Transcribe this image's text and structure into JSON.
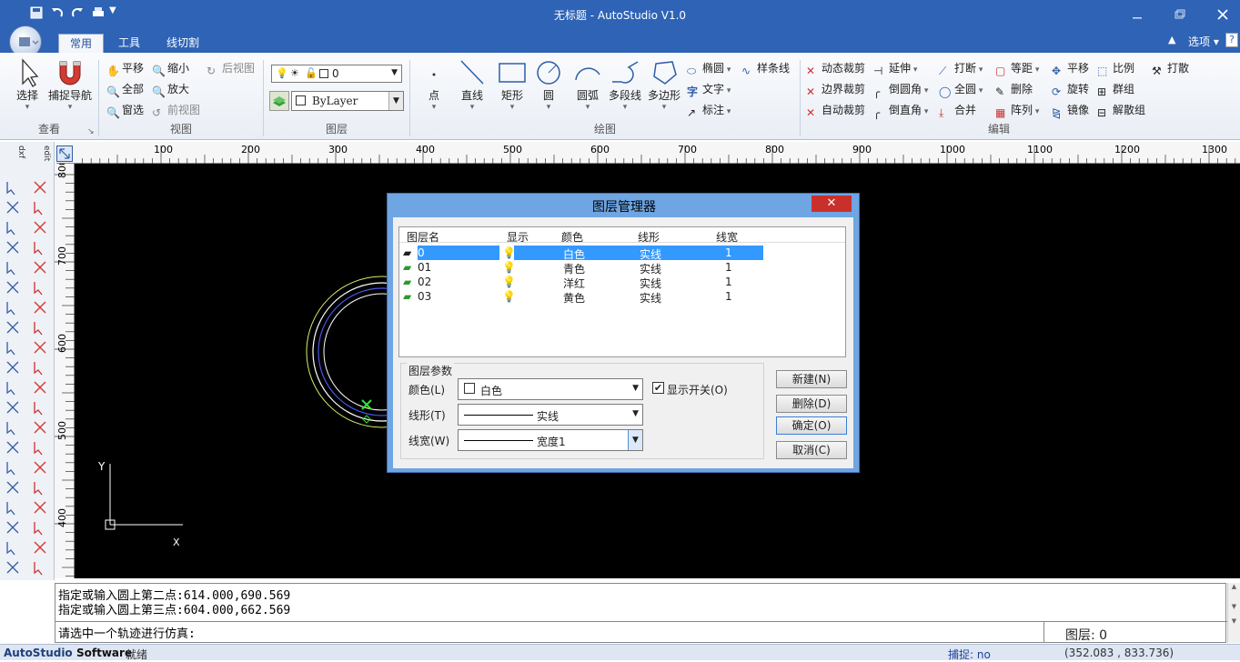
{
  "window": {
    "title": "无标题 - AutoStudio V1.0",
    "options_label": "选项"
  },
  "tabs": [
    "常用",
    "工具",
    "线切割"
  ],
  "ribbon": {
    "view_group": {
      "label": "查看",
      "select": "选择",
      "snap_nav": "捕捉导航"
    },
    "zoom_group": {
      "label": "视图",
      "pan": "平移",
      "zoom_out": "缩小",
      "all": "全部",
      "zoom_in": "放大",
      "window": "窗选",
      "prev_view": "前视图",
      "next_view": "后视图"
    },
    "layer_group": {
      "label": "图层",
      "current_layer": "0",
      "linetype": "ByLayer"
    },
    "draw_group": {
      "label": "绘图",
      "items": [
        "点",
        "直线",
        "矩形",
        "圆",
        "圆弧",
        "多段线",
        "多边形"
      ],
      "ellipse": "椭圆",
      "spline": "样条线",
      "text": "文字",
      "dim": "标注"
    },
    "edit_group": {
      "label": "编辑",
      "c1": [
        "动态裁剪",
        "边界裁剪",
        "自动裁剪"
      ],
      "c2": [
        "延伸",
        "倒圆角",
        "倒直角"
      ],
      "c3": [
        "打断",
        "全圆",
        "合并"
      ],
      "c4": [
        "等距",
        "删除",
        "阵列"
      ],
      "c5": [
        "平移",
        "旋转",
        "镜像"
      ],
      "c6": [
        "比例",
        "群组",
        "解散组"
      ],
      "c7": [
        "打散"
      ]
    }
  },
  "ruler": {
    "h": [
      "100",
      "200",
      "300",
      "400",
      "500",
      "600",
      "700",
      "800",
      "900",
      "1000",
      "1100",
      "1200",
      "1300"
    ],
    "v": [
      "800",
      "700",
      "600",
      "500",
      "400"
    ]
  },
  "axis": {
    "x": "X",
    "y": "Y"
  },
  "left_toolbar": {
    "a": "dxf",
    "b": "edit"
  },
  "dialog": {
    "title": "图层管理器",
    "close": "✕",
    "columns": [
      "图层名",
      "显示",
      "颜色",
      "线形",
      "线宽"
    ],
    "rows": [
      {
        "name": "0",
        "color": "白色",
        "linetype": "实线",
        "width": "1"
      },
      {
        "name": "01",
        "color": "青色",
        "linetype": "实线",
        "width": "1"
      },
      {
        "name": "02",
        "color": "洋红",
        "linetype": "实线",
        "width": "1"
      },
      {
        "name": "03",
        "color": "黄色",
        "linetype": "实线",
        "width": "1"
      }
    ],
    "params": {
      "title": "图层参数",
      "color_label": "颜色(L)",
      "color_value": "白色",
      "linetype_label": "线形(T)",
      "linetype_value": "实线",
      "width_label": "线宽(W)",
      "width_value": "宽度1",
      "show_switch": "显示开关(O)"
    },
    "buttons": {
      "new": "新建(N)",
      "delete": "删除(D)",
      "ok": "确定(O)",
      "cancel": "取消(C)"
    }
  },
  "command": {
    "lines": [
      "指定或输入圆上第二点:614.000,690.569",
      "指定或输入圆上第三点:604.000,662.569"
    ],
    "prompt": "请选中一个轨迹进行仿真:",
    "layer_status": "图层: 0"
  },
  "status": {
    "brand": "AutoStudio",
    "brand2": "Software",
    "state": "就绪",
    "snap": "捕捉: no",
    "coords": "(352.083 , 833.736)"
  },
  "colors": {
    "title_bar": "#2e63b5",
    "canvas": "#000000",
    "dialog_frame": "#6fa5e2",
    "selection": "#3399ff"
  }
}
